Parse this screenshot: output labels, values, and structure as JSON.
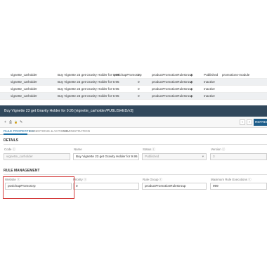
{
  "grid_rows": [
    {
      "id": "vignette_carholder",
      "name": "Buy Vignette 23 get Gravity Holder for 9.95",
      "website": "posichapPromoGrp",
      "num": "0",
      "group": "productPromotionRuleGroup",
      "priority": "3",
      "status": "Published",
      "module": "promotions-module"
    },
    {
      "id": "vignette_carholder",
      "name": "Buy Vignette 23 get Gravity Holder for 9.95",
      "website": "",
      "num": "0",
      "group": "productPromotionRuleGroup",
      "priority": "2",
      "status": "Inactive",
      "module": ""
    },
    {
      "id": "vignette_carholder",
      "name": "Buy Vignette 23 get Gravity Holder for 9.95",
      "website": "",
      "num": "0",
      "group": "productPromotionRuleGroup",
      "priority": "1",
      "status": "Inactive",
      "module": ""
    },
    {
      "id": "vignette_carholder",
      "name": "Buy Vignette 23 get Gravity Holder for 9.95",
      "website": "",
      "num": "0",
      "group": "productPromotionRuleGroup",
      "priority": "1",
      "status": "Inactive",
      "module": ""
    }
  ],
  "detail_title": "Buy Vignette 23 get Gravity Holder for 9.95 [vignette_carholder/PUBLISHED/v3]",
  "toolbar": {
    "icon_new": "+",
    "icon_save": "⎙",
    "icon_lock": "🔒",
    "icon_edit": "✎",
    "prev": "‹",
    "next": "›",
    "refresh": "REFRESH"
  },
  "tabs": [
    "RULE PROPERTIES",
    "CONDITIONS & ACTIONS",
    "ADMINISTRATION"
  ],
  "details": {
    "title": "DETAILS",
    "code_label": "Code ⓘ",
    "code_value": "vignette_carholder",
    "name_label": "Name",
    "name_value": "Buy Vignette 23 get Gravity Holder for 9.95",
    "status_label": "Status ⓘ",
    "status_value": "Published",
    "version_label": "Version ⓘ",
    "version_value": "3"
  },
  "rule_management": {
    "title": "RULE MANAGEMENT",
    "website_label": "Website ⓘ",
    "website_value": "posichapPromoGrp",
    "priority_label": "Priority ⓘ",
    "priority_value": "0",
    "rule_group_label": "Rule Group ⓘ",
    "rule_group_value": "productPromotionRuleGroup",
    "max_exec_label": "Maximum Rule Executions ⓘ",
    "max_exec_value": "999"
  },
  "colors": {
    "header_bg": "#31485c",
    "accent": "#1a6fa3",
    "highlight": "#d43a3a"
  }
}
